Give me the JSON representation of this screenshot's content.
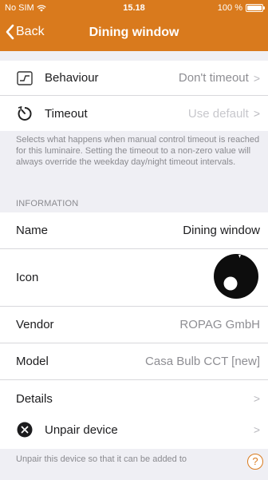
{
  "statusbar": {
    "carrier": "No SIM",
    "time": "15.18",
    "battery_text": "100 %",
    "battery_level": 1.0
  },
  "navbar": {
    "back_label": "Back",
    "title": "Dining window"
  },
  "control_group": {
    "items": [
      {
        "icon": "behaviour-chart-icon",
        "label": "Behaviour",
        "value": "Don't timeout"
      },
      {
        "icon": "timer-icon",
        "label": "Timeout",
        "value": "Use default"
      }
    ],
    "footnote": "Selects what happens when manual control timeout is reached for this luminaire. Setting the timeout to a non-zero value will always override the weekday day/night timeout intervals."
  },
  "information": {
    "header": "INFORMATION",
    "name_label": "Name",
    "name_value": "Dining window",
    "icon_label": "Icon",
    "vendor_label": "Vendor",
    "vendor_value": "ROPAG GmbH",
    "model_label": "Model",
    "model_value": "Casa Bulb CCT [new]",
    "details_label": "Details"
  },
  "unpair": {
    "label": "Unpair device",
    "footnote": "Unpair this device so that it can be added to"
  },
  "help_label": "?",
  "colors": {
    "accent": "#d97a1d",
    "background": "#efeff4",
    "secondary_text": "#8e8e93"
  }
}
